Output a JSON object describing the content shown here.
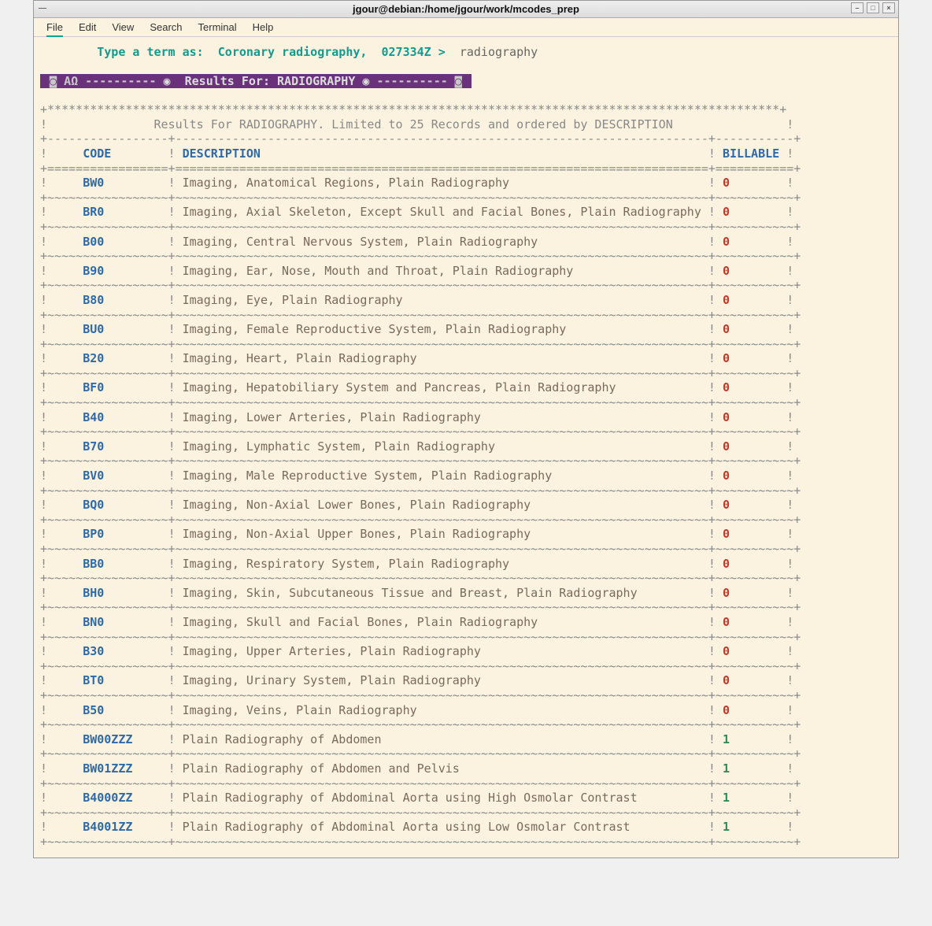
{
  "window": {
    "title": "jgour@debian:/home/jgour/work/mcodes_prep"
  },
  "menu": {
    "file": "File",
    "edit": "Edit",
    "view": "View",
    "search": "Search",
    "terminal": "Terminal",
    "help": "Help"
  },
  "prompt": {
    "label": "Type a term as:",
    "eg1": "Coronary radiography,",
    "eg2": "027334Z >",
    "value": "radiography"
  },
  "banner": {
    "left": "◙ ΑΩ ----------",
    "mid": "◉  Results For: RADIOGRAPHY ◉",
    "right": "---------- ◙"
  },
  "summary": {
    "text": "Results For RADIOGRAPHY. Limited to 25 Records and ordered by DESCRIPTION"
  },
  "headers": {
    "code": "CODE",
    "desc": "DESCRIPTION",
    "bill": "BILLABLE"
  },
  "rows": [
    {
      "code": "BW0",
      "desc": "Imaging, Anatomical Regions, Plain Radiography",
      "bill": "0"
    },
    {
      "code": "BR0",
      "desc": "Imaging, Axial Skeleton, Except Skull and Facial Bones, Plain Radiography",
      "bill": "0"
    },
    {
      "code": "B00",
      "desc": "Imaging, Central Nervous System, Plain Radiography",
      "bill": "0"
    },
    {
      "code": "B90",
      "desc": "Imaging, Ear, Nose, Mouth and Throat, Plain Radiography",
      "bill": "0"
    },
    {
      "code": "B80",
      "desc": "Imaging, Eye, Plain Radiography",
      "bill": "0"
    },
    {
      "code": "BU0",
      "desc": "Imaging, Female Reproductive System, Plain Radiography",
      "bill": "0"
    },
    {
      "code": "B20",
      "desc": "Imaging, Heart, Plain Radiography",
      "bill": "0"
    },
    {
      "code": "BF0",
      "desc": "Imaging, Hepatobiliary System and Pancreas, Plain Radiography",
      "bill": "0"
    },
    {
      "code": "B40",
      "desc": "Imaging, Lower Arteries, Plain Radiography",
      "bill": "0"
    },
    {
      "code": "B70",
      "desc": "Imaging, Lymphatic System, Plain Radiography",
      "bill": "0"
    },
    {
      "code": "BV0",
      "desc": "Imaging, Male Reproductive System, Plain Radiography",
      "bill": "0"
    },
    {
      "code": "BQ0",
      "desc": "Imaging, Non-Axial Lower Bones, Plain Radiography",
      "bill": "0"
    },
    {
      "code": "BP0",
      "desc": "Imaging, Non-Axial Upper Bones, Plain Radiography",
      "bill": "0"
    },
    {
      "code": "BB0",
      "desc": "Imaging, Respiratory System, Plain Radiography",
      "bill": "0"
    },
    {
      "code": "BH0",
      "desc": "Imaging, Skin, Subcutaneous Tissue and Breast, Plain Radiography",
      "bill": "0"
    },
    {
      "code": "BN0",
      "desc": "Imaging, Skull and Facial Bones, Plain Radiography",
      "bill": "0"
    },
    {
      "code": "B30",
      "desc": "Imaging, Upper Arteries, Plain Radiography",
      "bill": "0"
    },
    {
      "code": "BT0",
      "desc": "Imaging, Urinary System, Plain Radiography",
      "bill": "0"
    },
    {
      "code": "B50",
      "desc": "Imaging, Veins, Plain Radiography",
      "bill": "0"
    },
    {
      "code": "BW00ZZZ",
      "desc": "Plain Radiography of Abdomen",
      "bill": "1"
    },
    {
      "code": "BW01ZZZ",
      "desc": "Plain Radiography of Abdomen and Pelvis",
      "bill": "1"
    },
    {
      "code": "B4000ZZ",
      "desc": "Plain Radiography of Abdominal Aorta using High Osmolar Contrast",
      "bill": "1"
    },
    {
      "code": "B4001ZZ",
      "desc": "Plain Radiography of Abdominal Aorta using Low Osmolar Contrast",
      "bill": "1"
    }
  ]
}
